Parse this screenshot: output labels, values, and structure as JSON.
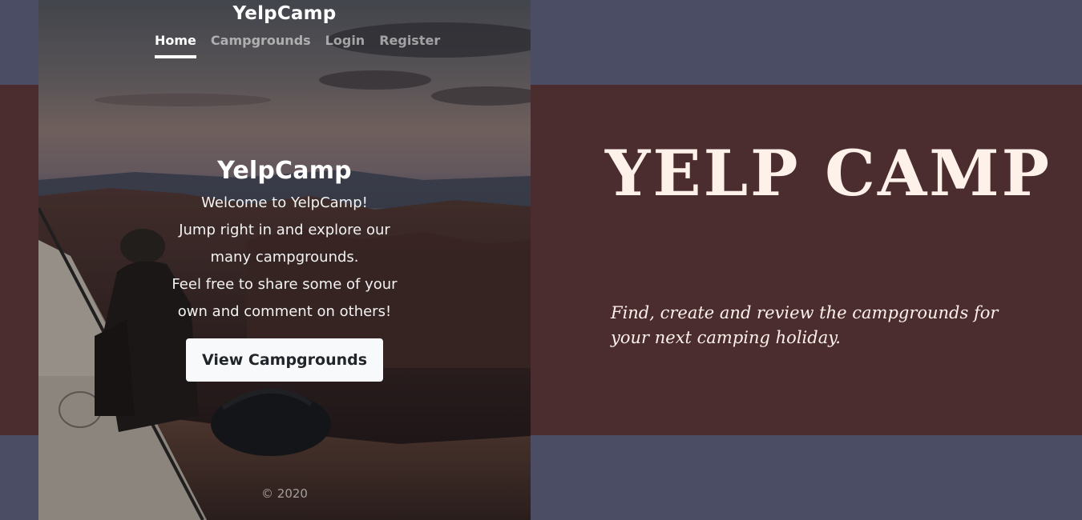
{
  "landing": {
    "brand": "YelpCamp",
    "nav": {
      "home": "Home",
      "campgrounds": "Campgrounds",
      "login": "Login",
      "register": "Register",
      "active": "Home"
    },
    "cover": {
      "heading": "YelpCamp",
      "lines": [
        "Welcome to YelpCamp!",
        "Jump right in and explore our",
        "many campgrounds.",
        "Feel free to share some of your",
        "own and comment on others!"
      ],
      "button_label": "View Campgrounds"
    },
    "footer": "© 2020"
  },
  "promo": {
    "title": "YELP CAMP",
    "subtitle_line1": "Find, create and review the campgrounds for",
    "subtitle_line2": "your next camping holiday."
  },
  "colors": {
    "background": "#4b4d64",
    "band": "#4b2d2f",
    "title_text": "#fdf1ea",
    "button_bg": "#f8f9fa"
  },
  "icons": {
    "hero_image": "camper-at-sunset-photo"
  }
}
